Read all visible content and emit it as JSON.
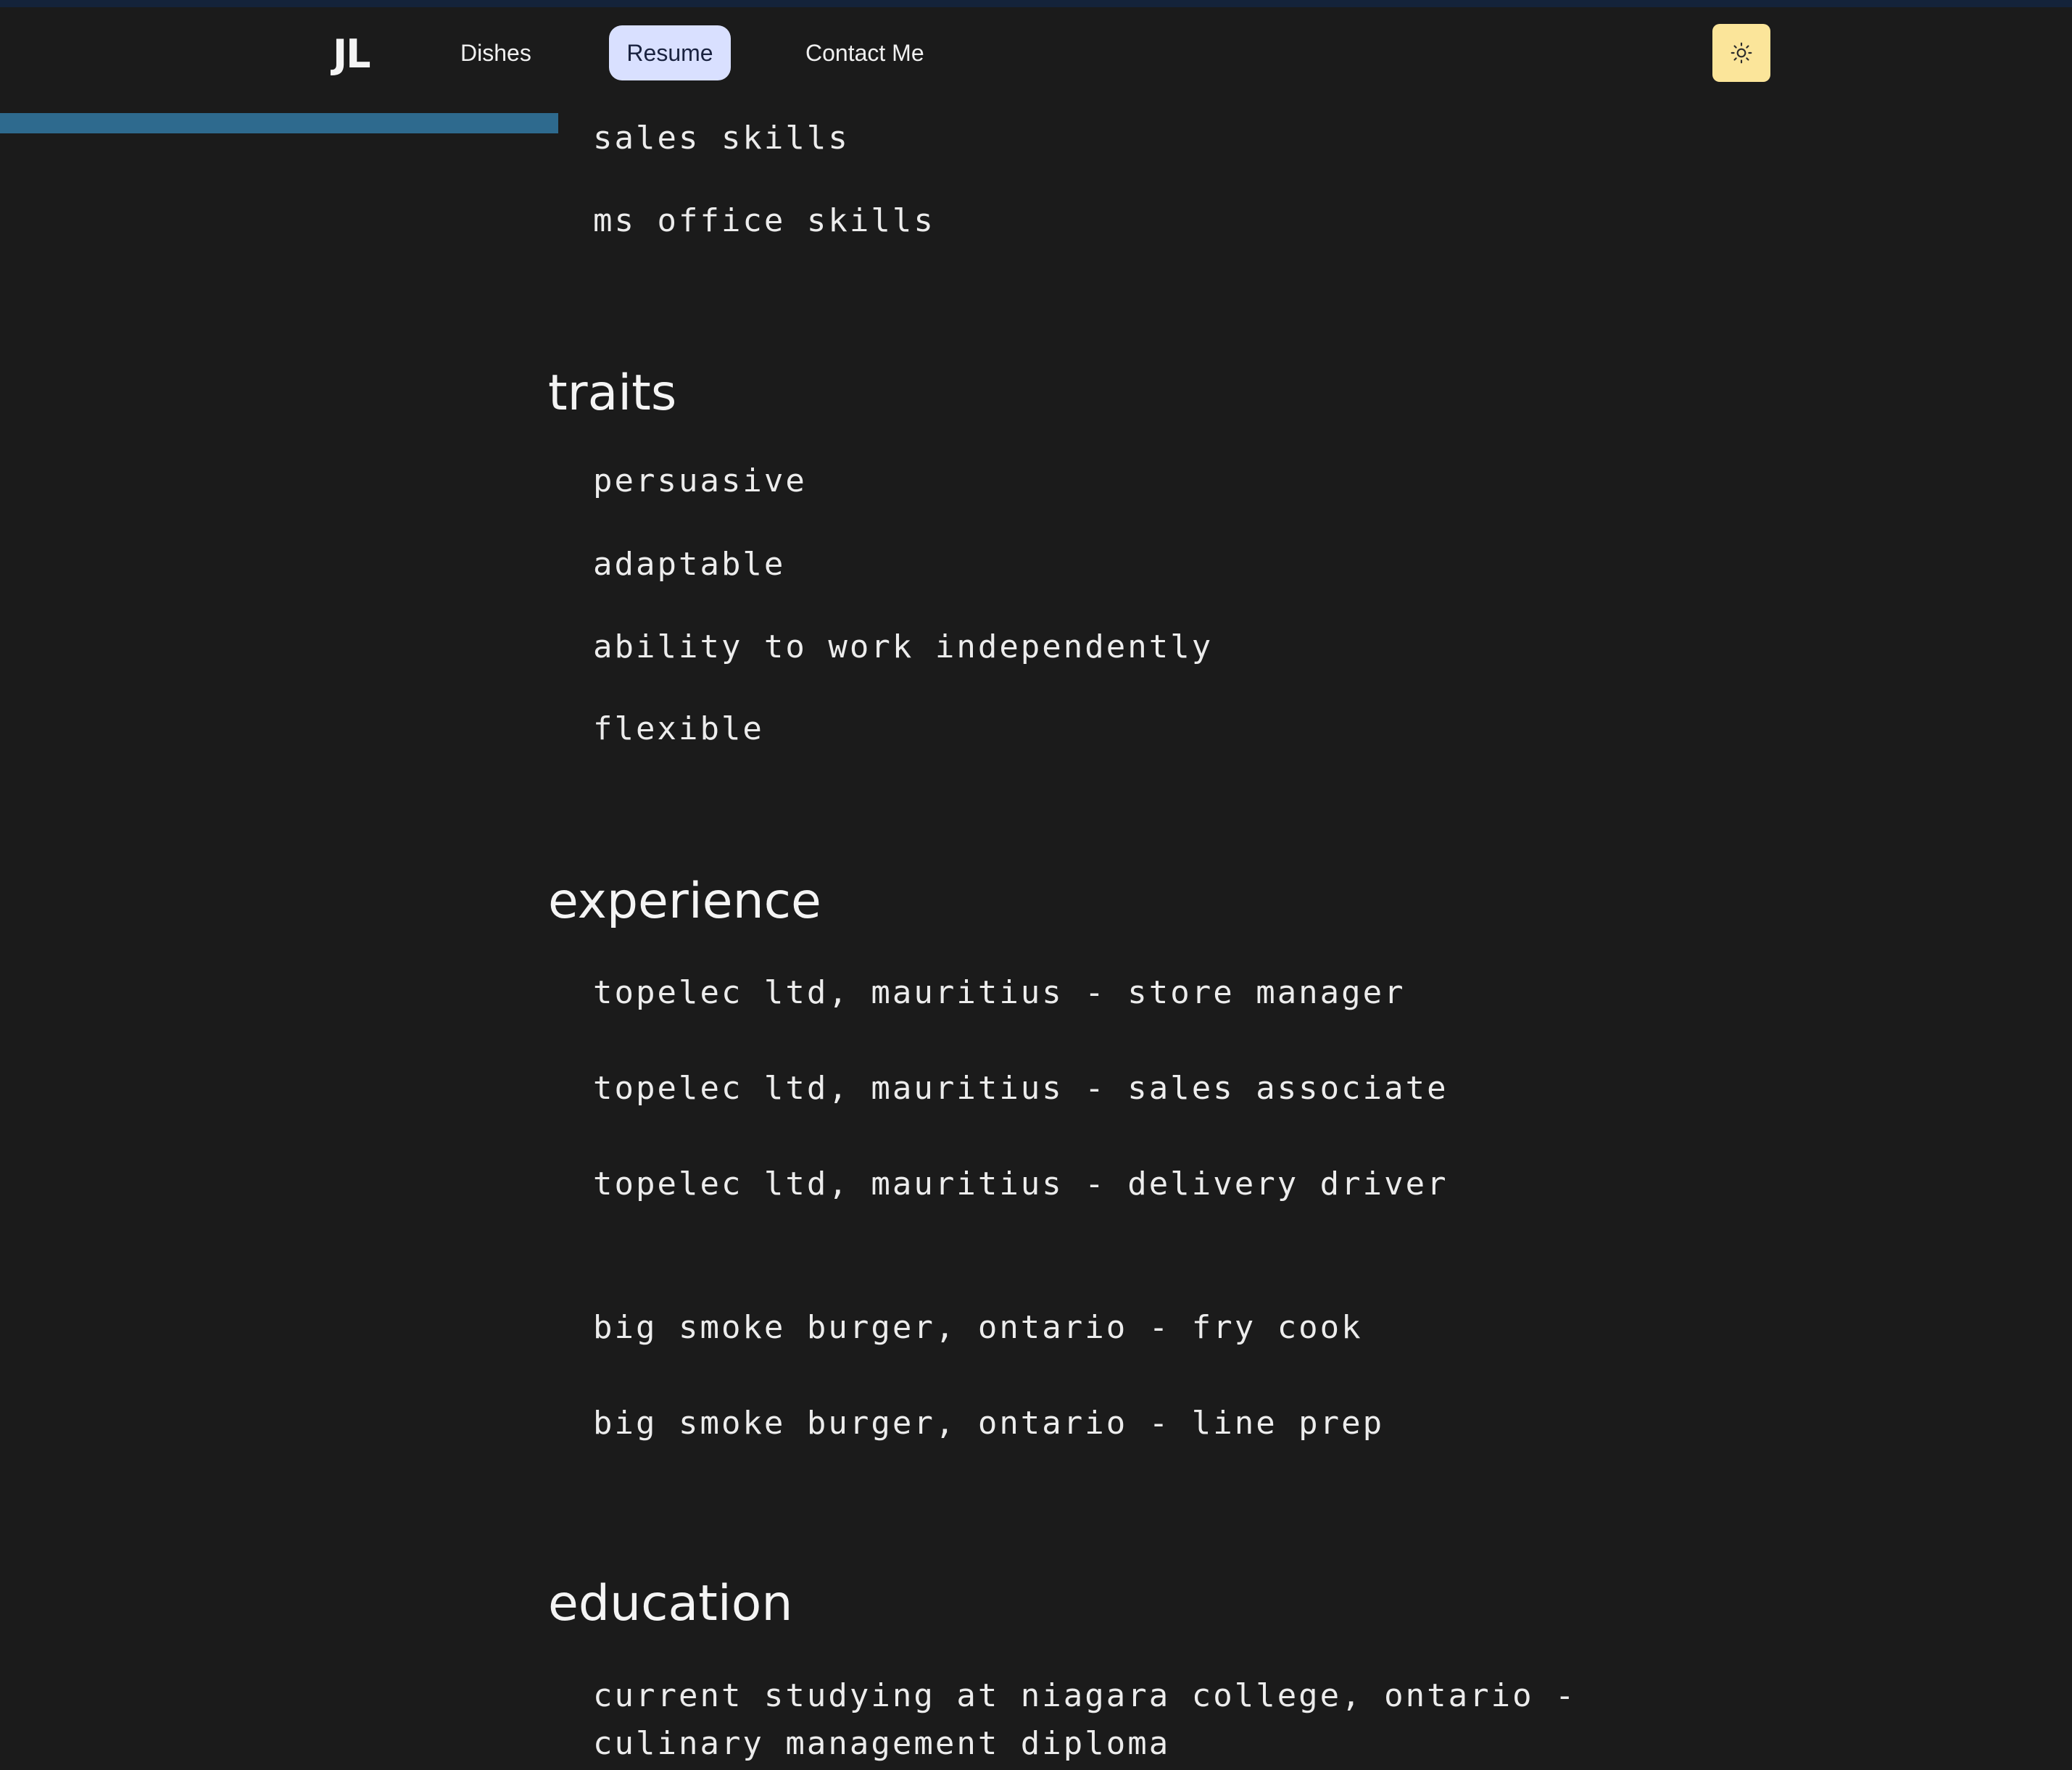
{
  "nav": {
    "brand": "JL",
    "links": [
      "Dishes",
      "Resume",
      "Contact Me"
    ],
    "active": "Resume",
    "theme_toggle_icon": "sun-icon"
  },
  "colors": {
    "background": "#1b1b1b",
    "active_tab_bg": "#d9e0ff",
    "toggle_bg": "#fbe59a",
    "progress_bar": "#2e6a8e"
  },
  "skills": {
    "items": [
      "sales skills",
      "ms office skills"
    ]
  },
  "traits": {
    "heading": "traits",
    "items": [
      "persuasive",
      "adaptable",
      "ability to work independently",
      "flexible"
    ]
  },
  "experience": {
    "heading": "experience",
    "items": [
      "topelec ltd, mauritius - store manager",
      "topelec ltd, mauritius - sales associate",
      "topelec ltd, mauritius - delivery driver",
      "big smoke burger, ontario - fry cook",
      "big smoke burger, ontario - line prep"
    ]
  },
  "education": {
    "heading": "education",
    "items": [
      "current studying at niagara college, ontario -",
      "culinary management diploma"
    ]
  }
}
